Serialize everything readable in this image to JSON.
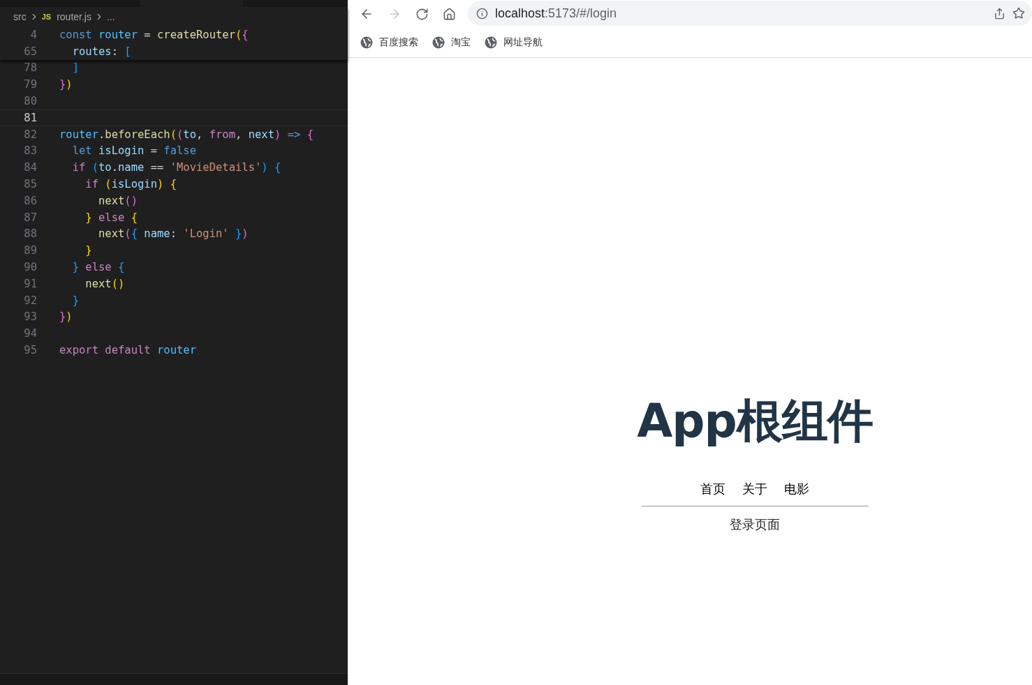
{
  "editor": {
    "breadcrumb": [
      {
        "text": "src",
        "kind": "folder"
      },
      {
        "text": "router.js",
        "kind": "jsfile"
      },
      {
        "text": "...",
        "kind": "more"
      }
    ],
    "file_badge": "JS",
    "sticky_lines": [
      {
        "number": "4",
        "tokens": [
          {
            "text": "const",
            "kind": "keyword"
          },
          {
            "text": " router",
            "kind": "constant"
          },
          {
            "text": " = ",
            "kind": "plain"
          },
          {
            "text": "createRouter",
            "kind": "func"
          },
          {
            "text": "(",
            "kind": "b1"
          },
          {
            "text": "{",
            "kind": "b2"
          }
        ]
      },
      {
        "number": "65",
        "tokens": [
          {
            "text": "  routes",
            "kind": "var"
          },
          {
            "text": ": ",
            "kind": "plain"
          },
          {
            "text": "[",
            "kind": "b3"
          }
        ]
      }
    ],
    "lines": [
      {
        "number": "78",
        "current": false,
        "tokens": [
          {
            "text": "  ]",
            "kind": "b3"
          }
        ]
      },
      {
        "number": "79",
        "current": false,
        "tokens": [
          {
            "text": "}",
            "kind": "b2"
          },
          {
            "text": ")",
            "kind": "b1"
          }
        ]
      },
      {
        "number": "80",
        "current": false
      },
      {
        "number": "81",
        "current": true
      },
      {
        "number": "82",
        "current": false,
        "tokens": [
          {
            "text": "router",
            "kind": "constant"
          },
          {
            "text": ".",
            "kind": "plain"
          },
          {
            "text": "beforeEach",
            "kind": "func"
          },
          {
            "text": "(",
            "kind": "b1"
          },
          {
            "text": "(",
            "kind": "b2"
          },
          {
            "text": "to",
            "kind": "var"
          },
          {
            "text": ", ",
            "kind": "plain"
          },
          {
            "text": "from",
            "kind": "control"
          },
          {
            "text": ", ",
            "kind": "plain"
          },
          {
            "text": "next",
            "kind": "var"
          },
          {
            "text": ")",
            "kind": "b2"
          },
          {
            "text": " =>",
            "kind": "keyword"
          },
          {
            "text": " {",
            "kind": "b2"
          }
        ]
      },
      {
        "number": "83",
        "current": false,
        "tokens": [
          {
            "text": "  let",
            "kind": "keyword"
          },
          {
            "text": " isLogin",
            "kind": "var"
          },
          {
            "text": " = ",
            "kind": "plain"
          },
          {
            "text": "false",
            "kind": "keyword"
          }
        ]
      },
      {
        "number": "84",
        "current": false,
        "tokens": [
          {
            "text": "  if",
            "kind": "control"
          },
          {
            "text": " (",
            "kind": "b3"
          },
          {
            "text": "to",
            "kind": "var"
          },
          {
            "text": ".",
            "kind": "plain"
          },
          {
            "text": "name",
            "kind": "var"
          },
          {
            "text": " == ",
            "kind": "plain"
          },
          {
            "text": "'MovieDetails'",
            "kind": "string"
          },
          {
            "text": ")",
            "kind": "b3"
          },
          {
            "text": " {",
            "kind": "b3"
          }
        ]
      },
      {
        "number": "85",
        "current": false,
        "tokens": [
          {
            "text": "    if",
            "kind": "control"
          },
          {
            "text": " (",
            "kind": "b1"
          },
          {
            "text": "isLogin",
            "kind": "var"
          },
          {
            "text": ")",
            "kind": "b1"
          },
          {
            "text": " {",
            "kind": "b1"
          }
        ]
      },
      {
        "number": "86",
        "current": false,
        "tokens": [
          {
            "text": "      next",
            "kind": "func"
          },
          {
            "text": "(",
            "kind": "b2"
          },
          {
            "text": ")",
            "kind": "b2"
          }
        ]
      },
      {
        "number": "87",
        "current": false,
        "tokens": [
          {
            "text": "    }",
            "kind": "b1"
          },
          {
            "text": " else",
            "kind": "control"
          },
          {
            "text": " {",
            "kind": "b1"
          }
        ]
      },
      {
        "number": "88",
        "current": false,
        "tokens": [
          {
            "text": "      next",
            "kind": "func"
          },
          {
            "text": "(",
            "kind": "b2"
          },
          {
            "text": "{",
            "kind": "b3"
          },
          {
            "text": " name",
            "kind": "var"
          },
          {
            "text": ": ",
            "kind": "plain"
          },
          {
            "text": "'Login'",
            "kind": "string"
          },
          {
            "text": " }",
            "kind": "b3"
          },
          {
            "text": ")",
            "kind": "b2"
          }
        ]
      },
      {
        "number": "89",
        "current": false,
        "tokens": [
          {
            "text": "    }",
            "kind": "b1"
          }
        ]
      },
      {
        "number": "90",
        "current": false,
        "tokens": [
          {
            "text": "  }",
            "kind": "b3"
          },
          {
            "text": " else",
            "kind": "control"
          },
          {
            "text": " {",
            "kind": "b3"
          }
        ]
      },
      {
        "number": "91",
        "current": false,
        "tokens": [
          {
            "text": "    next",
            "kind": "func"
          },
          {
            "text": "(",
            "kind": "b1"
          },
          {
            "text": ")",
            "kind": "b1"
          }
        ]
      },
      {
        "number": "92",
        "current": false,
        "tokens": [
          {
            "text": "  }",
            "kind": "b3"
          }
        ]
      },
      {
        "number": "93",
        "current": false,
        "tokens": [
          {
            "text": "}",
            "kind": "b2"
          },
          {
            "text": ")",
            "kind": "b1"
          }
        ]
      },
      {
        "number": "94",
        "current": false
      },
      {
        "number": "95",
        "current": false,
        "tokens": [
          {
            "text": "export",
            "kind": "control"
          },
          {
            "text": " default",
            "kind": "control"
          },
          {
            "text": " router",
            "kind": "constant"
          }
        ]
      }
    ]
  },
  "browser": {
    "url_host": "localhost",
    "url_rest": ":5173/#/login",
    "forward_disabled": true,
    "bookmarks": [
      "百度搜索",
      "淘宝",
      "网址导航"
    ]
  },
  "page": {
    "title": "App根组件",
    "nav_links": [
      "首页",
      "关于",
      "电影"
    ],
    "view_text": "登录页面"
  }
}
